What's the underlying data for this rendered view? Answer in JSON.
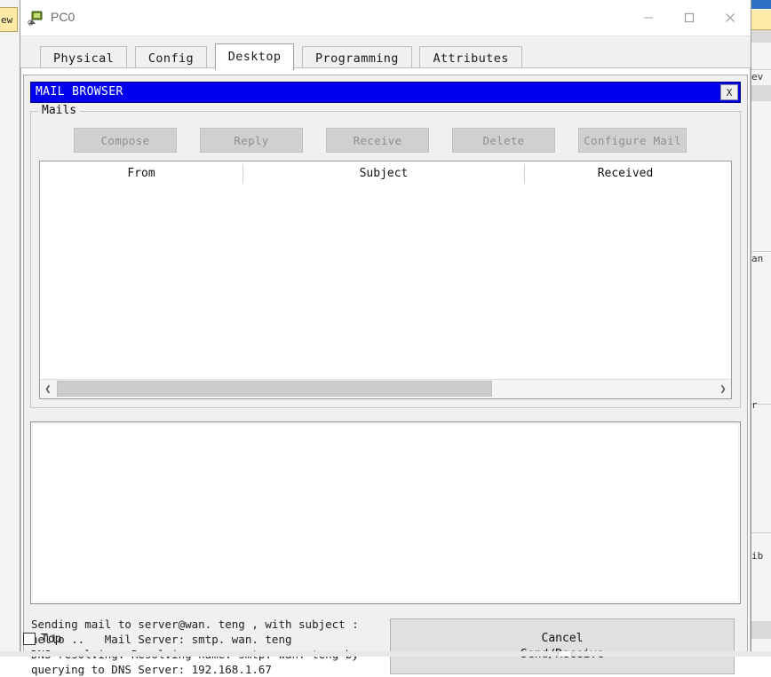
{
  "window": {
    "title": "PC0",
    "icon": "pc-device-icon",
    "controls": {
      "minimize": "minimize-icon",
      "maximize": "maximize-icon",
      "close": "close-icon"
    }
  },
  "tabs": [
    {
      "label": "Physical",
      "active": false
    },
    {
      "label": "Config",
      "active": false
    },
    {
      "label": "Desktop",
      "active": true
    },
    {
      "label": "Programming",
      "active": false
    },
    {
      "label": "Attributes",
      "active": false
    }
  ],
  "mail_browser": {
    "title": "MAIL BROWSER",
    "close_label": "X",
    "group_legend": "Mails",
    "buttons": [
      {
        "label": "Compose",
        "enabled": false
      },
      {
        "label": "Reply",
        "enabled": false
      },
      {
        "label": "Receive",
        "enabled": false
      },
      {
        "label": "Delete",
        "enabled": false
      },
      {
        "label": "Configure Mail",
        "enabled": false
      }
    ],
    "columns": [
      "From",
      "Subject",
      "Received"
    ],
    "rows": [],
    "message_body": "",
    "scrollbar": {
      "left_arrow": "chevron-left-icon",
      "right_arrow": "chevron-right-icon",
      "thumb_fraction": "66%"
    }
  },
  "status": {
    "text": "Sending mail to server@wan. teng , with subject :\nhello ..   Mail Server: smtp. wan. teng\nDNS resolving. Resolving name: smtp. wan. teng by\nquerying to DNS Server: 192.168.1.67"
  },
  "footer": {
    "cancel_line1": "Cancel",
    "cancel_line2": "Send/Receive",
    "top_label": "Top",
    "top_checked": false
  },
  "background": {
    "left_fragment": "ew",
    "right_fragments": [
      "ev",
      "an",
      "r",
      "ib"
    ]
  },
  "colors": {
    "title_bar_blue": "#0000ee",
    "panel_grey": "#f0f0f0",
    "button_grey": "#d0d0d0",
    "disabled_text": "#8f8f8f",
    "accent_yellow": "#ffe9a6"
  }
}
